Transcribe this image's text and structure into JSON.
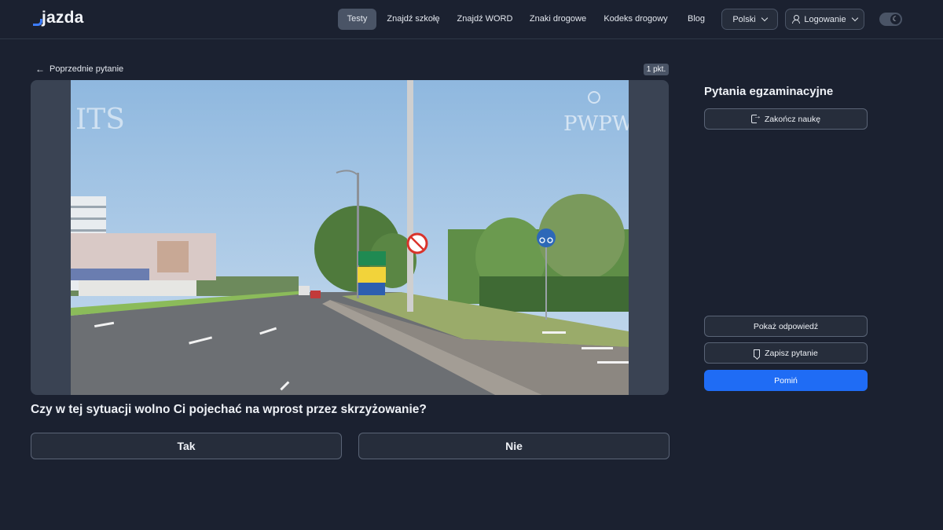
{
  "header": {
    "logo_text": "jazda",
    "nav": [
      "Testy",
      "Znajdź szkołę",
      "Znajdź WORD",
      "Znaki drogowe",
      "Kodeks drogowy",
      "Blog"
    ],
    "language": "Polski",
    "login": "Logowanie",
    "accent_color": "#3d7dff"
  },
  "content": {
    "back_label": "Poprzednie pytanie",
    "points": "1 pkt.",
    "watermark_left": "ITS",
    "watermark_right": "PWPW",
    "question": "Czy w tej sytuacji wolno Ci pojechać na wprost przez skrzyżowanie?",
    "answers": [
      "Tak",
      "Nie"
    ]
  },
  "sidebar": {
    "title": "Pytania egzaminacyjne",
    "end_label": "Zakończ naukę",
    "show_answer_label": "Pokaż odpowiedź",
    "save_label": "Zapisz pytanie",
    "skip_label": "Pomiń",
    "primary_color": "#1f6cf5"
  }
}
